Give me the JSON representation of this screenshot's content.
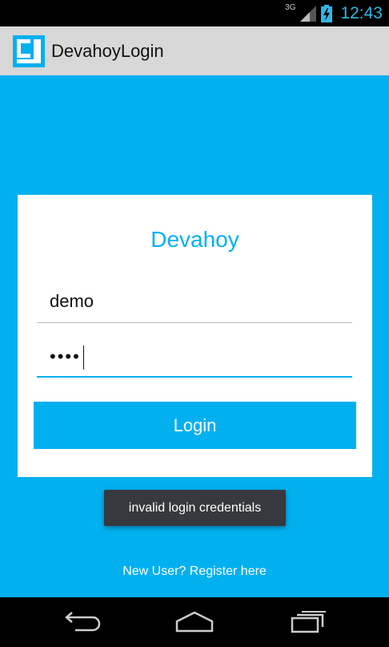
{
  "status_bar": {
    "network_label": "3G",
    "time": "12:43"
  },
  "app": {
    "title": "DevahoyLogin",
    "accent_color": "#03b0ef"
  },
  "login_card": {
    "title": "Devahoy",
    "username_value": "demo",
    "password_masked": "••••",
    "login_button_label": "Login"
  },
  "toast": {
    "message": "invalid login credentials"
  },
  "register": {
    "label": "New User? Register here"
  },
  "nav_bar": {
    "icons": [
      "back-icon",
      "home-icon",
      "recent-apps-icon"
    ]
  }
}
